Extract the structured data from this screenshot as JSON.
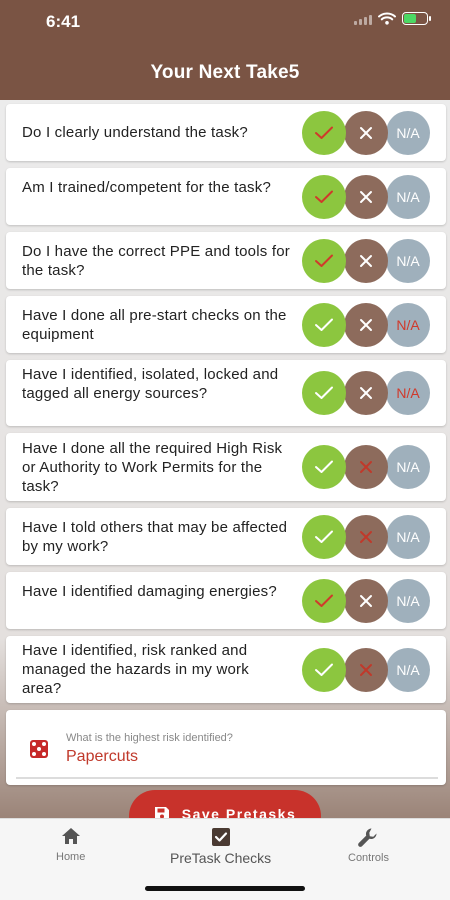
{
  "status_bar": {
    "time": "6:41"
  },
  "header": {
    "title": "Your Next Take5"
  },
  "questions": [
    {
      "text": "Do I clearly understand the task?",
      "yes": "✓",
      "no": "✕",
      "na": "N/A",
      "answer": "yes"
    },
    {
      "text": "Am I trained/competent for the task?",
      "yes": "✓",
      "no": "✕",
      "na": "N/A",
      "answer": "yes"
    },
    {
      "text": "Do I have the correct PPE and tools for the task?",
      "yes": "✓",
      "no": "✕",
      "na": "N/A",
      "answer": "yes"
    },
    {
      "text": "Have I done all pre-start checks on the equipment",
      "yes": "✓",
      "no": "✕",
      "na": "N/A",
      "answer": "na"
    },
    {
      "text": "Have I identified, isolated, locked and tagged all energy sources?",
      "yes": "✓",
      "no": "✕",
      "na": "N/A",
      "answer": "na"
    },
    {
      "text": "Have I done all the required High Risk or Authority to Work Permits for the task?",
      "yes": "✓",
      "no": "✕",
      "na": "N/A",
      "answer": "no"
    },
    {
      "text": "Have I told others that may be affected by my work?",
      "yes": "✓",
      "no": "✕",
      "na": "N/A",
      "answer": "no"
    },
    {
      "text": "Have I identified damaging energies?",
      "yes": "✓",
      "no": "✕",
      "na": "N/A",
      "answer": "yes"
    },
    {
      "text": "Have I identified, risk ranked and managed the hazards in my work area?",
      "yes": "✓",
      "no": "✕",
      "na": "N/A",
      "answer": "no"
    }
  ],
  "risk": {
    "label": "What is the highest risk identified?",
    "value": "Papercuts"
  },
  "save_button": {
    "label": "Save Pretasks"
  },
  "tabs": [
    {
      "label": "Home",
      "icon": "home-icon"
    },
    {
      "label": "PreTask Checks",
      "icon": "checkbox-icon"
    },
    {
      "label": "Controls",
      "icon": "wrench-icon"
    }
  ],
  "colors": {
    "header": "#7a5444",
    "yes": "#8cc63f",
    "no": "#8d6b5c",
    "na": "#9fb0bc",
    "selected_mark": "#d0392b",
    "accent": "#c8322b"
  }
}
